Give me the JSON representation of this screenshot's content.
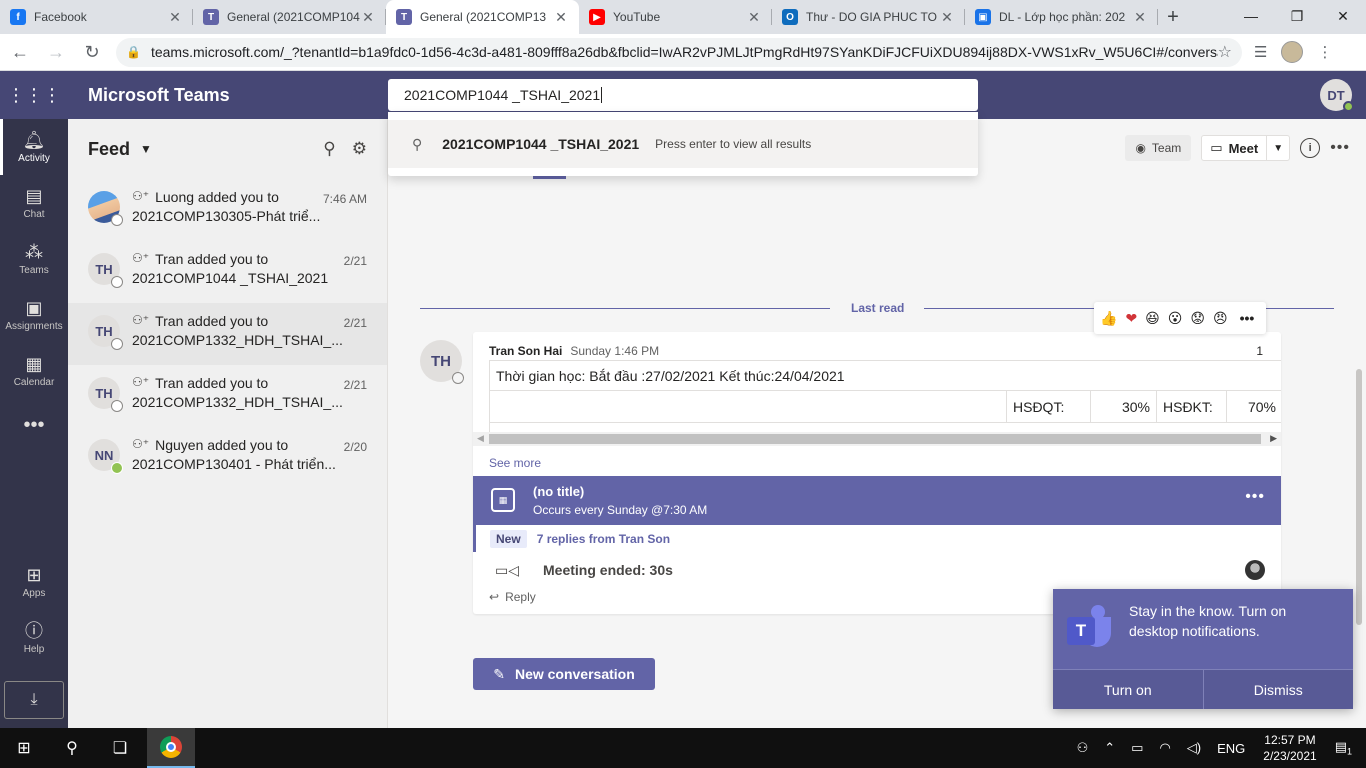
{
  "browser": {
    "tabs": [
      {
        "title": "Facebook",
        "icon": "facebook-icon",
        "color": "#1877f2",
        "active": false
      },
      {
        "title": "General (2021COMP104",
        "icon": "teams-icon",
        "color": "#6264a7",
        "active": false
      },
      {
        "title": "General (2021COMP13",
        "icon": "teams-icon",
        "color": "#6264a7",
        "active": true
      },
      {
        "title": "YouTube",
        "icon": "youtube-icon",
        "color": "#ff0000",
        "active": false
      },
      {
        "title": "Thư - DO GIA PHUC TO",
        "icon": "outlook-icon",
        "color": "#0f6cbd",
        "active": false
      },
      {
        "title": "DL - Lớp học phần: 202",
        "icon": "classroom-icon",
        "color": "#1a73e8",
        "active": false
      }
    ],
    "url": "teams.microsoft.com/_?tenantId=b1a9fdc0-1d56-4c3d-a481-809fff8a26db&fbclid=IwAR2vPJMLJtPmgRdHt97SYanKDiFJCFUiXDU894ij88DX-VWS1xRv_W5U6CI#/conversatio..."
  },
  "header": {
    "app_name": "Microsoft Teams",
    "search_value": "2021COMP1044 _TSHAI_2021",
    "user_initials": "DT"
  },
  "search_dropdown": {
    "query": "2021COMP1044 _TSHAI_2021",
    "hint": "Press enter to view all results"
  },
  "rail": {
    "items": [
      {
        "label": "Activity",
        "icon": "bell-icon",
        "active": true
      },
      {
        "label": "Chat",
        "icon": "chat-icon",
        "active": false
      },
      {
        "label": "Teams",
        "icon": "teams-icon",
        "active": false
      },
      {
        "label": "Assignments",
        "icon": "assignments-icon",
        "active": false
      },
      {
        "label": "Calendar",
        "icon": "calendar-icon",
        "active": false
      },
      {
        "label": "...",
        "icon": "more-icon",
        "active": false
      }
    ],
    "apps_label": "Apps",
    "help_label": "Help"
  },
  "feed": {
    "title": "Feed",
    "items": [
      {
        "initials": "",
        "line1": "Luong added you to",
        "line2": "2021COMP130305-Phát triể...",
        "time": "7:46 AM",
        "photo": true,
        "selected": false
      },
      {
        "initials": "TH",
        "line1": "Tran added you to",
        "line2": "2021COMP1044 _TSHAI_2021",
        "time": "2/21",
        "photo": false,
        "selected": false
      },
      {
        "initials": "TH",
        "line1": "Tran added you to",
        "line2": "2021COMP1332_HDH_TSHAI_...",
        "time": "2/21",
        "photo": false,
        "selected": true
      },
      {
        "initials": "TH",
        "line1": "Tran added you to",
        "line2": "2021COMP1332_HDH_TSHAI_...",
        "time": "2/21",
        "photo": false,
        "selected": false
      },
      {
        "initials": "NN",
        "line1": "Nguyen added you to",
        "line2": "2021COMP130401 - Phát triển...",
        "time": "2/20",
        "photo": false,
        "selected": false
      }
    ]
  },
  "channel": {
    "team_label": "Team",
    "meet_label": "Meet",
    "last_read": "Last read",
    "reactions": [
      "👍",
      "❤",
      "😆",
      "😮",
      "😟",
      "😠"
    ],
    "post": {
      "initials": "TH",
      "author": "Tran Son Hai",
      "when": "Sunday 1:46 PM",
      "count": "1",
      "content_line": "Thời gian học: Bắt đầu :27/02/2021 Kết thúc:24/04/2021",
      "cells": [
        "HSĐQT:",
        "30%",
        "HSĐKT:",
        "70%"
      ],
      "see_more": "See more",
      "meeting_title": "(no title)",
      "meeting_sub": "Occurs every Sunday @7:30 AM",
      "new_badge": "New",
      "replies": "7 replies from Tran Son",
      "meeting_ended": "Meeting ended: 30s",
      "reply": "Reply"
    },
    "new_conversation": "New conversation"
  },
  "toast": {
    "message": "Stay in the know. Turn on desktop notifications.",
    "turn_on": "Turn on",
    "dismiss": "Dismiss"
  },
  "taskbar": {
    "lang": "ENG",
    "time": "12:57 PM",
    "date": "2/23/2021",
    "notif_count": "1"
  }
}
